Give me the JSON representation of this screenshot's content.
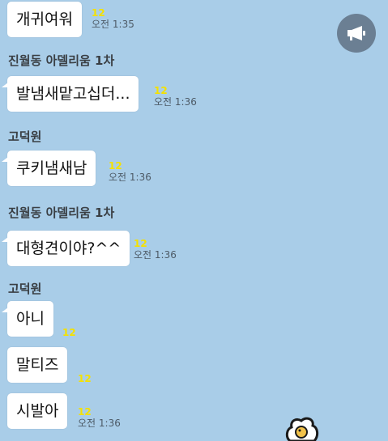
{
  "messages": [
    {
      "sender": "",
      "text": "개귀여워",
      "unread": "12",
      "time": "오전 1:35"
    },
    {
      "sender": "진월동 아델리움 1차",
      "text": "발냄새맡고십더...",
      "unread": "12",
      "time": "오전 1:36"
    },
    {
      "sender": "고덕원",
      "text": "쿠키냄새남",
      "unread": "12",
      "time": "오전 1:36"
    },
    {
      "sender": "진월동 아델리움 1차",
      "text": "대형견이야?^^",
      "unread": "12",
      "time": "오전 1:36"
    },
    {
      "sender": "고덕원",
      "text": "아니",
      "unread": "12",
      "time": ""
    },
    {
      "sender": "",
      "text": "말티즈",
      "unread": "12",
      "time": ""
    },
    {
      "sender": "",
      "text": "시발아",
      "unread": "12",
      "time": "오전 1:36"
    }
  ],
  "notice_button": {
    "icon": "megaphone-icon"
  },
  "sticker": {
    "icon": "cookie-icon"
  },
  "colors": {
    "background": "#a9cde8",
    "unread": "#f5e100",
    "bubble": "#ffffff"
  }
}
